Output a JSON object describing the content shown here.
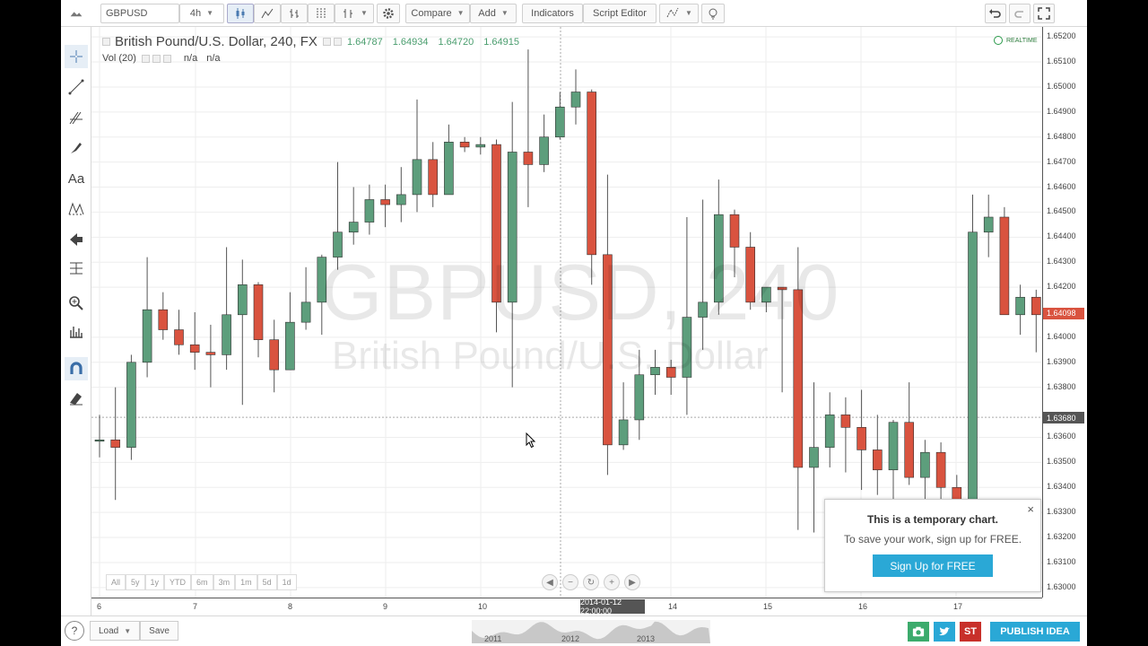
{
  "toolbar": {
    "symbol": "GBPUSD",
    "interval": "4h",
    "compare_label": "Compare",
    "add_label": "Add",
    "indicators_label": "Indicators",
    "script_editor_label": "Script Editor"
  },
  "legend": {
    "title": "British Pound/U.S. Dollar, 240, FX",
    "open": "1.64787",
    "high": "1.64934",
    "low": "1.64720",
    "close": "1.64915",
    "vol_label": "Vol (20)",
    "vol_value1": "n/a",
    "vol_value2": "n/a",
    "realtime": "REALTIME"
  },
  "watermark": {
    "line1": "GBPUSD, 240",
    "line2": "British Pound/U.S. Dollar"
  },
  "price_axis": {
    "labels": [
      "1.65200",
      "1.65100",
      "1.65000",
      "1.64900",
      "1.64800",
      "1.64700",
      "1.64600",
      "1.64500",
      "1.64400",
      "1.64300",
      "1.64200",
      "1.64000",
      "1.63900",
      "1.63800",
      "1.63600",
      "1.63500",
      "1.63400",
      "1.63300",
      "1.63200",
      "1.63100",
      "1.63000"
    ],
    "last_price": "1.64098",
    "crosshair_price": "1.63680",
    "last_color": "#d9533f",
    "crosshair_color": "#555555"
  },
  "time_axis": {
    "labels": [
      "6",
      "7",
      "8",
      "9",
      "10",
      "14",
      "15",
      "16",
      "17"
    ],
    "crosshair_time": "2014-01-12 22:00:00"
  },
  "ranges": [
    "All",
    "5y",
    "1y",
    "YTD",
    "6m",
    "3m",
    "1m",
    "5d",
    "1d"
  ],
  "popup": {
    "title": "This is a temporary chart.",
    "subtitle": "To save your work, sign up for FREE.",
    "button": "Sign Up for FREE",
    "close": "×"
  },
  "bottombar": {
    "help": "?",
    "load_label": "Load",
    "save_label": "Save",
    "minimap_years": [
      "2011",
      "2012",
      "2013"
    ],
    "st_label": "ST",
    "publish_label": "PUBLISH IDEA"
  },
  "colors": {
    "up": "#5d9e7c",
    "down": "#d9533f",
    "accent": "#2aa8d6"
  },
  "chart_data": {
    "type": "candlestick",
    "symbol": "GBPUSD",
    "timeframe": "240",
    "ylim": [
      1.6296,
      1.6524
    ],
    "candles": [
      {
        "o": 1.6359,
        "h": 1.6369,
        "l": 1.6352,
        "c": 1.6359
      },
      {
        "o": 1.6359,
        "h": 1.638,
        "l": 1.6335,
        "c": 1.6356
      },
      {
        "o": 1.6356,
        "h": 1.6393,
        "l": 1.6351,
        "c": 1.639
      },
      {
        "o": 1.639,
        "h": 1.6432,
        "l": 1.6384,
        "c": 1.6411
      },
      {
        "o": 1.6411,
        "h": 1.6418,
        "l": 1.6399,
        "c": 1.6403
      },
      {
        "o": 1.6403,
        "h": 1.6411,
        "l": 1.6393,
        "c": 1.6397
      },
      {
        "o": 1.6397,
        "h": 1.641,
        "l": 1.6387,
        "c": 1.6394
      },
      {
        "o": 1.6394,
        "h": 1.6405,
        "l": 1.638,
        "c": 1.6393
      },
      {
        "o": 1.6393,
        "h": 1.6436,
        "l": 1.6387,
        "c": 1.6409
      },
      {
        "o": 1.6409,
        "h": 1.6431,
        "l": 1.6373,
        "c": 1.6421
      },
      {
        "o": 1.6421,
        "h": 1.6422,
        "l": 1.6392,
        "c": 1.6399
      },
      {
        "o": 1.6399,
        "h": 1.6407,
        "l": 1.6378,
        "c": 1.6387
      },
      {
        "o": 1.6387,
        "h": 1.6418,
        "l": 1.6387,
        "c": 1.6406
      },
      {
        "o": 1.6406,
        "h": 1.6428,
        "l": 1.6403,
        "c": 1.6414
      },
      {
        "o": 1.6414,
        "h": 1.6433,
        "l": 1.6401,
        "c": 1.6432
      },
      {
        "o": 1.6432,
        "h": 1.647,
        "l": 1.6427,
        "c": 1.6442
      },
      {
        "o": 1.6442,
        "h": 1.646,
        "l": 1.6437,
        "c": 1.6446
      },
      {
        "o": 1.6446,
        "h": 1.6461,
        "l": 1.6441,
        "c": 1.6455
      },
      {
        "o": 1.6455,
        "h": 1.6461,
        "l": 1.6444,
        "c": 1.6453
      },
      {
        "o": 1.6453,
        "h": 1.6468,
        "l": 1.6446,
        "c": 1.6457
      },
      {
        "o": 1.6457,
        "h": 1.6495,
        "l": 1.645,
        "c": 1.6471
      },
      {
        "o": 1.6471,
        "h": 1.6478,
        "l": 1.6452,
        "c": 1.6457
      },
      {
        "o": 1.6457,
        "h": 1.6485,
        "l": 1.6457,
        "c": 1.6478
      },
      {
        "o": 1.6478,
        "h": 1.648,
        "l": 1.6474,
        "c": 1.6476
      },
      {
        "o": 1.6476,
        "h": 1.648,
        "l": 1.6473,
        "c": 1.6477
      },
      {
        "o": 1.6477,
        "h": 1.6479,
        "l": 1.6402,
        "c": 1.6414
      },
      {
        "o": 1.6414,
        "h": 1.6494,
        "l": 1.638,
        "c": 1.6474
      },
      {
        "o": 1.6474,
        "h": 1.6515,
        "l": 1.6452,
        "c": 1.6469
      },
      {
        "o": 1.6469,
        "h": 1.6489,
        "l": 1.6466,
        "c": 1.648
      },
      {
        "o": 1.648,
        "h": 1.6498,
        "l": 1.6479,
        "c": 1.6492
      },
      {
        "o": 1.6492,
        "h": 1.6507,
        "l": 1.6485,
        "c": 1.6498
      },
      {
        "o": 1.6498,
        "h": 1.6499,
        "l": 1.6421,
        "c": 1.6433
      },
      {
        "o": 1.6433,
        "h": 1.6465,
        "l": 1.6345,
        "c": 1.6357
      },
      {
        "o": 1.6357,
        "h": 1.6382,
        "l": 1.6355,
        "c": 1.6367
      },
      {
        "o": 1.6367,
        "h": 1.6395,
        "l": 1.6359,
        "c": 1.6385
      },
      {
        "o": 1.6385,
        "h": 1.6395,
        "l": 1.6377,
        "c": 1.6388
      },
      {
        "o": 1.6388,
        "h": 1.6391,
        "l": 1.6377,
        "c": 1.6384
      },
      {
        "o": 1.6384,
        "h": 1.6448,
        "l": 1.6369,
        "c": 1.6408
      },
      {
        "o": 1.6408,
        "h": 1.6455,
        "l": 1.6395,
        "c": 1.6414
      },
      {
        "o": 1.6414,
        "h": 1.6463,
        "l": 1.6409,
        "c": 1.6449
      },
      {
        "o": 1.6449,
        "h": 1.6451,
        "l": 1.6424,
        "c": 1.6436
      },
      {
        "o": 1.6436,
        "h": 1.6442,
        "l": 1.6411,
        "c": 1.6414
      },
      {
        "o": 1.6414,
        "h": 1.642,
        "l": 1.641,
        "c": 1.642
      },
      {
        "o": 1.642,
        "h": 1.642,
        "l": 1.6378,
        "c": 1.6419
      },
      {
        "o": 1.6419,
        "h": 1.6436,
        "l": 1.6323,
        "c": 1.6348
      },
      {
        "o": 1.6348,
        "h": 1.6382,
        "l": 1.6322,
        "c": 1.6356
      },
      {
        "o": 1.6356,
        "h": 1.6378,
        "l": 1.6348,
        "c": 1.6369
      },
      {
        "o": 1.6369,
        "h": 1.6376,
        "l": 1.6346,
        "c": 1.6364
      },
      {
        "o": 1.6364,
        "h": 1.6379,
        "l": 1.6339,
        "c": 1.6355
      },
      {
        "o": 1.6355,
        "h": 1.6369,
        "l": 1.6337,
        "c": 1.6347
      },
      {
        "o": 1.6347,
        "h": 1.6367,
        "l": 1.6331,
        "c": 1.6366
      },
      {
        "o": 1.6366,
        "h": 1.6382,
        "l": 1.6341,
        "c": 1.6344
      },
      {
        "o": 1.6344,
        "h": 1.6359,
        "l": 1.6331,
        "c": 1.6354
      },
      {
        "o": 1.6354,
        "h": 1.6358,
        "l": 1.6325,
        "c": 1.634
      },
      {
        "o": 1.634,
        "h": 1.6345,
        "l": 1.632,
        "c": 1.6332
      },
      {
        "o": 1.6332,
        "h": 1.6457,
        "l": 1.6329,
        "c": 1.6442
      },
      {
        "o": 1.6442,
        "h": 1.6457,
        "l": 1.6432,
        "c": 1.6448
      },
      {
        "o": 1.6448,
        "h": 1.6452,
        "l": 1.6409,
        "c": 1.6409
      },
      {
        "o": 1.6409,
        "h": 1.6421,
        "l": 1.6401,
        "c": 1.6416
      },
      {
        "o": 1.6416,
        "h": 1.6419,
        "l": 1.6394,
        "c": 1.6409
      }
    ]
  }
}
